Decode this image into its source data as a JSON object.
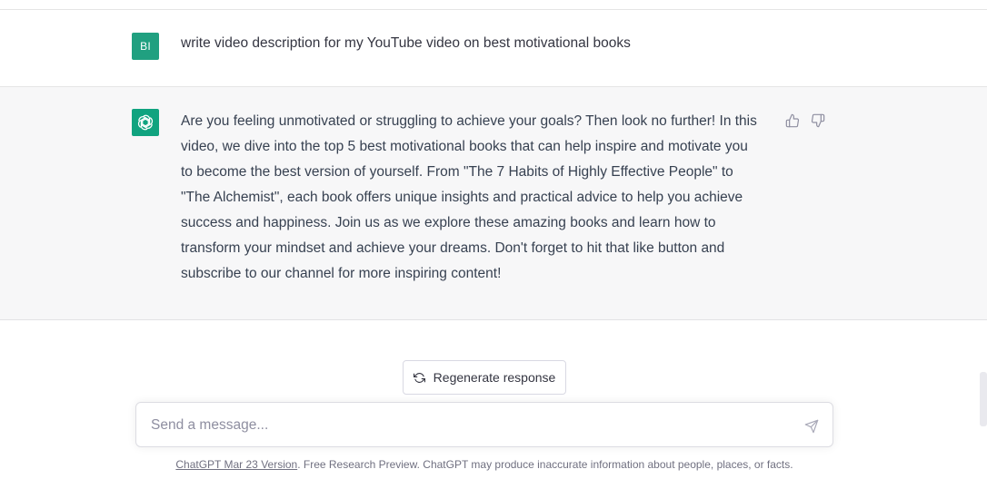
{
  "user_message": {
    "avatar_initials": "BI",
    "text": "write video description for my YouTube video on best motivational books"
  },
  "assistant_message": {
    "avatar_icon": "openai-logo-icon",
    "lines": [
      "Are you feeling unmotivated or struggling to achieve your goals? Then look no further! In this",
      "video, we dive into the top 5 best motivational books that can help inspire and motivate you",
      "to become the best version of yourself. From \"The 7 Habits of Highly Effective People\" to",
      "\"The Alchemist\", each book offers unique insights and practical advice to help you achieve",
      "success and happiness. Join us as we explore these amazing books and learn how to",
      "transform your mindset and achieve your dreams. Don't forget to hit that like button and",
      "subscribe to our channel for more inspiring content!"
    ],
    "feedback_icons": [
      "thumbs-up-icon",
      "thumbs-down-icon"
    ]
  },
  "regenerate": {
    "label": "Regenerate response",
    "icon": "refresh-icon"
  },
  "composer": {
    "placeholder": "Send a message...",
    "value": "",
    "send_icon": "send-icon"
  },
  "footer": {
    "link": "ChatGPT Mar 23 Version",
    "text": ". Free Research Preview. ChatGPT may produce inaccurate information about people, places, or facts."
  },
  "colors": {
    "user_avatar": "#20a080",
    "assistant_avatar": "#10a37f",
    "assistant_bg": "#f7f7f8",
    "text": "#343541"
  }
}
